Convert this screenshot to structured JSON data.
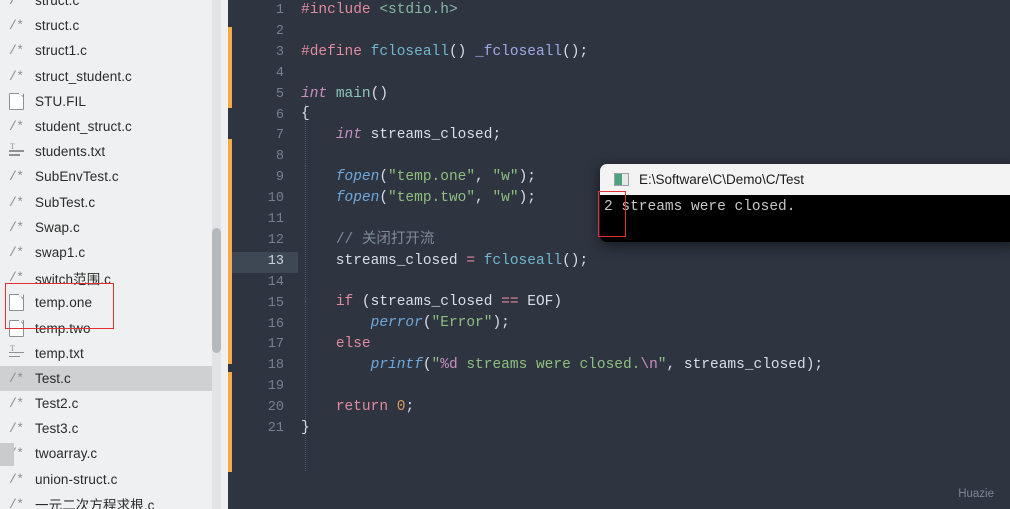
{
  "sidebar": {
    "files": [
      {
        "label": "struct.c",
        "icon": "c-source-icon",
        "cut": true
      },
      {
        "label": "struct.c",
        "icon": "c-source-icon"
      },
      {
        "label": "struct1.c",
        "icon": "c-source-icon"
      },
      {
        "label": "struct_student.c",
        "icon": "c-source-icon"
      },
      {
        "label": "STU.FIL",
        "icon": "file-icon"
      },
      {
        "label": "student_struct.c",
        "icon": "c-source-icon"
      },
      {
        "label": "students.txt",
        "icon": "text-file-icon"
      },
      {
        "label": "SubEnvTest.c",
        "icon": "c-source-icon"
      },
      {
        "label": "SubTest.c",
        "icon": "c-source-icon"
      },
      {
        "label": "Swap.c",
        "icon": "c-source-icon"
      },
      {
        "label": "swap1.c",
        "icon": "c-source-icon"
      },
      {
        "label": "switch范围.c",
        "icon": "c-source-icon"
      },
      {
        "label": "temp.one",
        "icon": "file-icon"
      },
      {
        "label": "temp.two",
        "icon": "file-icon"
      },
      {
        "label": "temp.txt",
        "icon": "text-file-icon"
      },
      {
        "label": "Test.c",
        "icon": "c-source-icon",
        "selected": true
      },
      {
        "label": "Test2.c",
        "icon": "c-source-icon"
      },
      {
        "label": "Test3.c",
        "icon": "c-source-icon"
      },
      {
        "label": "twoarray.c",
        "icon": "c-source-icon"
      },
      {
        "label": "union-struct.c",
        "icon": "c-source-icon"
      },
      {
        "label": "一元二次方程求根.c",
        "icon": "c-source-icon"
      }
    ]
  },
  "editor": {
    "line_numbers": [
      "1",
      "2",
      "3",
      "4",
      "5",
      "6",
      "7",
      "8",
      "9",
      "10",
      "11",
      "12",
      "13",
      "14",
      "15",
      "16",
      "17",
      "18",
      "19",
      "20",
      "21"
    ],
    "current_line": "13",
    "code_lines": [
      "#include <stdio.h>",
      "",
      "#define fcloseall() _fcloseall();",
      "",
      "int main()",
      "{",
      "    int streams_closed;",
      "",
      "    fopen(\"temp.one\", \"w\");",
      "    fopen(\"temp.two\", \"w\");",
      "",
      "    // 关闭打开流",
      "    streams_closed = fcloseall();",
      "",
      "    if (streams_closed == EOF)",
      "        perror(\"Error\");",
      "    else",
      "        printf(\"%d streams were closed.\\n\", streams_closed);",
      "",
      "    return 0;",
      "}"
    ]
  },
  "console": {
    "title": "E:\\Software\\C\\Demo\\C/Test",
    "output": "2 streams were closed.",
    "highlighted_value": "2"
  },
  "watermark": "Huazie",
  "colors": {
    "editor_bg": "#2e3440",
    "sidebar_bg": "#eff0f1",
    "selection_bg": "#cfd0d2",
    "vcs_marker": "#f6a94a",
    "annotation_red": "#e03030",
    "current_line_bg": "#3e4754",
    "console_bg": "#000000",
    "console_title_bg": "#f3f3f3"
  }
}
